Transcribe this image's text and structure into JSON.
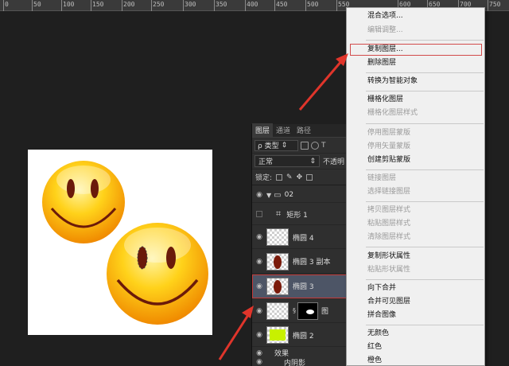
{
  "ruler": {
    "labels": [
      "0",
      "50",
      "100",
      "150",
      "200",
      "250",
      "300",
      "350",
      "400",
      "450",
      "500",
      "550",
      "600",
      "650",
      "700",
      "750"
    ]
  },
  "layers_panel": {
    "tabs": [
      "图层",
      "通道",
      "路径"
    ],
    "filter_label": "ρ 类型",
    "blend_mode": "正常",
    "opacity_label": "不透明",
    "lock_label": "锁定:",
    "layers": [
      {
        "name": "02"
      },
      {
        "name": "矩形 1"
      },
      {
        "name": "椭圆 4"
      },
      {
        "name": "椭圆 3 副本"
      },
      {
        "name": "椭圆 3"
      },
      {
        "name": "图"
      },
      {
        "name": "椭圆 2"
      },
      {
        "name": "效果"
      },
      {
        "name": "内阴影"
      }
    ]
  },
  "context_menu": {
    "items": [
      {
        "label": "混合选项...",
        "disabled": false
      },
      {
        "label": "编辑调整...",
        "disabled": true
      },
      {
        "label": "复制图层...",
        "disabled": false
      },
      {
        "label": "删除图层",
        "disabled": false
      },
      {
        "label": "转换为智能对象",
        "disabled": false
      },
      {
        "label": "栅格化图层",
        "disabled": false
      },
      {
        "label": "栅格化图层样式",
        "disabled": true
      },
      {
        "label": "停用图层蒙版",
        "disabled": true
      },
      {
        "label": "停用矢量蒙版",
        "disabled": true
      },
      {
        "label": "创建剪贴蒙版",
        "disabled": false
      },
      {
        "label": "链接图层",
        "disabled": true
      },
      {
        "label": "选择链接图层",
        "disabled": true
      },
      {
        "label": "拷贝图层样式",
        "disabled": true
      },
      {
        "label": "粘贴图层样式",
        "disabled": true
      },
      {
        "label": "清除图层样式",
        "disabled": true
      },
      {
        "label": "复制形状属性",
        "disabled": false
      },
      {
        "label": "粘贴形状属性",
        "disabled": true
      },
      {
        "label": "向下合并",
        "disabled": false
      },
      {
        "label": "合并可见图层",
        "disabled": false
      },
      {
        "label": "拼合图像",
        "disabled": false
      },
      {
        "label": "无颜色",
        "disabled": false
      },
      {
        "label": "红色",
        "disabled": false
      },
      {
        "label": "橙色",
        "disabled": false
      }
    ]
  },
  "colors": {
    "highlight_outline": "#d24b4b",
    "arrow": "#e0352b",
    "smiley_yellow": "#f5b800",
    "smiley_feature": "#6b1a0a"
  }
}
